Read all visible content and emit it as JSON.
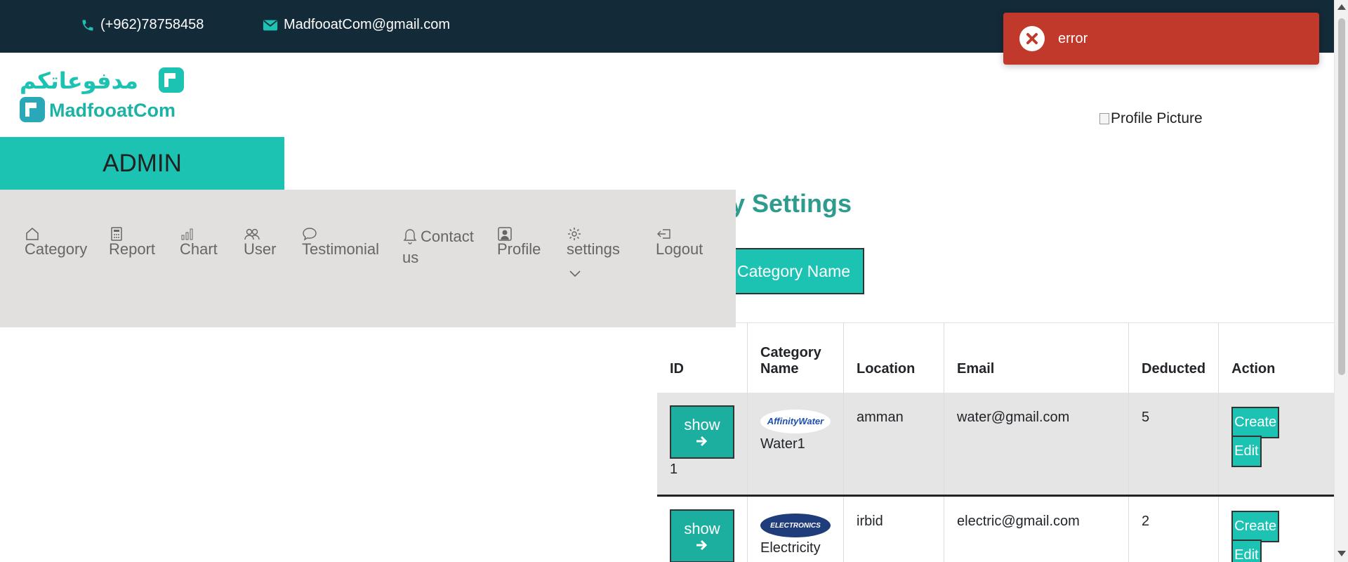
{
  "topbar": {
    "phone": "(+962)78758458",
    "email": "MadfooatCom@gmail.com",
    "bg_color": "#132a38"
  },
  "toast": {
    "message": "error",
    "icon": "error-x-icon",
    "color": "#c0392b"
  },
  "logo": {
    "arabic": "مدفوعاتكم",
    "latin": "MadfooatCom"
  },
  "profile": {
    "alt": "Profile Picture"
  },
  "sidebar": {
    "title": "ADMIN"
  },
  "nav": {
    "items": [
      {
        "label": "Category",
        "icon": "home-icon"
      },
      {
        "label": "Report",
        "icon": "calculator-icon"
      },
      {
        "label": "Chart",
        "icon": "bar-chart-icon"
      },
      {
        "label": "User",
        "icon": "users-icon"
      },
      {
        "label": "Testimonial",
        "icon": "chat-icon"
      },
      {
        "label": "Contact",
        "label2": "us",
        "icon": "bell-icon"
      },
      {
        "label": "Profile",
        "icon": "person-icon"
      },
      {
        "label": "settings",
        "icon": "gear-icon"
      },
      {
        "label": "Logout",
        "icon": "logout-icon"
      }
    ]
  },
  "main": {
    "title": "ory Settings",
    "category_button": "Category Name"
  },
  "table": {
    "headers": [
      "ID",
      "Category Name",
      "Location",
      "Email",
      "Deducted",
      "Action"
    ],
    "show_label": "show",
    "create_label": "Create",
    "edit_label": "Edit",
    "rows": [
      {
        "id": "1",
        "logo_text": "AffinityWater",
        "name": "Water1",
        "location": "amman",
        "email": "water@gmail.com",
        "deducted": "5"
      },
      {
        "id": "",
        "logo_text": "ELECTRONICS",
        "name": "Electricity",
        "location": "irbid",
        "email": "electric@gmail.com",
        "deducted": "2"
      }
    ]
  },
  "colors": {
    "accent": "#1cc3b2",
    "title": "#2e9b8f",
    "nav_bg": "#e2e0df"
  }
}
